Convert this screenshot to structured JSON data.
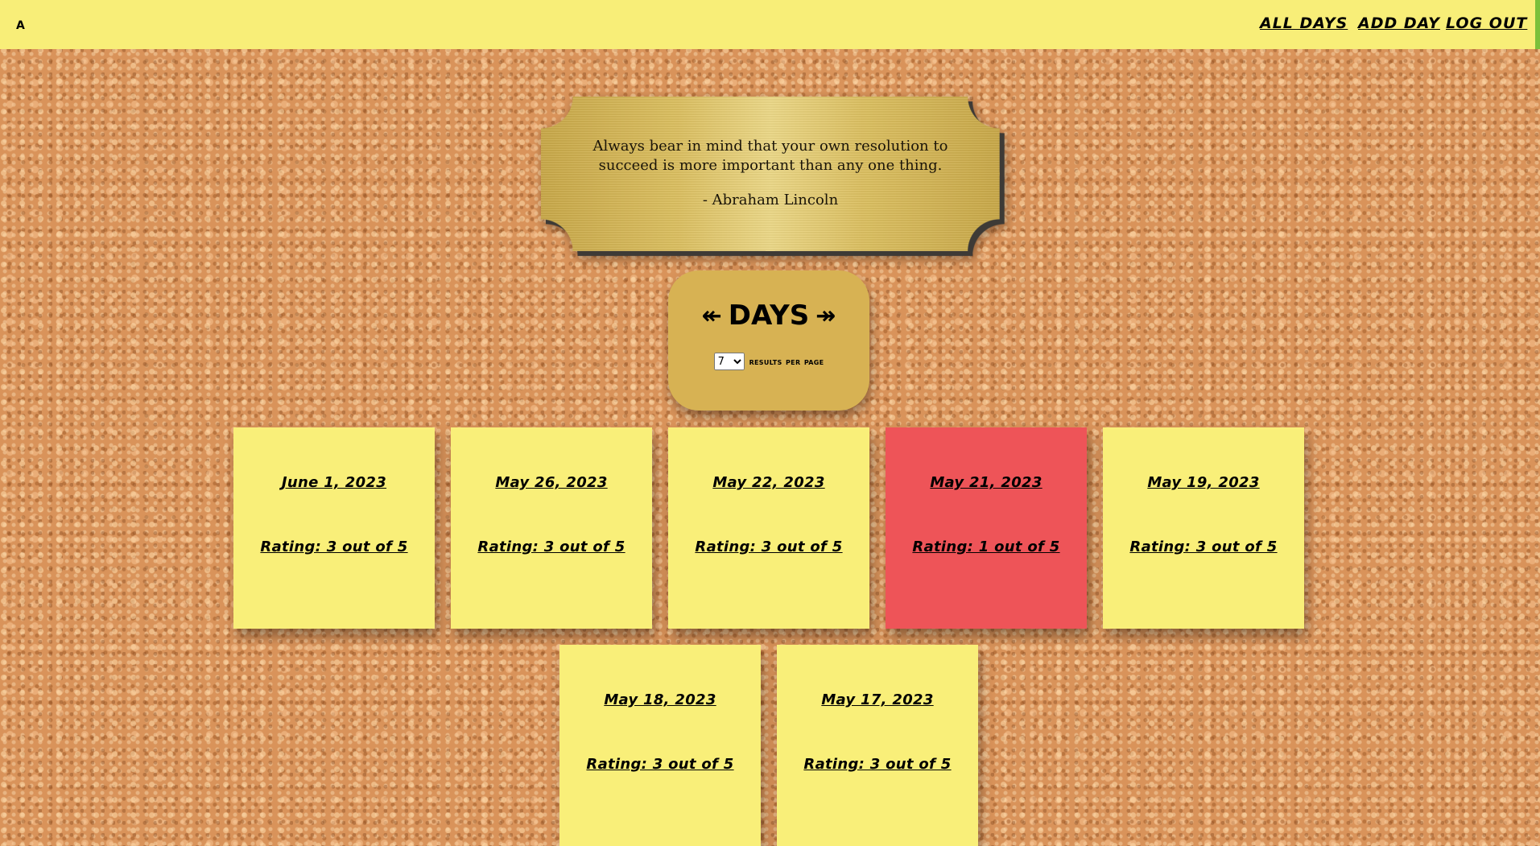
{
  "nav": {
    "brand": "A",
    "links": [
      "All Days",
      "Add Day",
      "Log Out"
    ]
  },
  "quote": {
    "text": "Always bear in mind that your own resolution to succeed is more important than any one thing.",
    "author": "- Abraham Lincoln"
  },
  "days_panel": {
    "prev_arrow": "↞",
    "title": "DAYS",
    "next_arrow": "↠",
    "per_page_value": "7",
    "per_page_options": [
      "7"
    ],
    "per_page_label": "results per page"
  },
  "days": [
    {
      "date": "June 1, 2023",
      "rating": "Rating: 3 out of 5",
      "color": "#f9ef79"
    },
    {
      "date": "May 26, 2023",
      "rating": "Rating: 3 out of 5",
      "color": "#f9ef79"
    },
    {
      "date": "May 22, 2023",
      "rating": "Rating: 3 out of 5",
      "color": "#f9ef79"
    },
    {
      "date": "May 21, 2023",
      "rating": "Rating: 1 out of 5",
      "color": "#ee5458"
    },
    {
      "date": "May 19, 2023",
      "rating": "Rating: 3 out of 5",
      "color": "#f9ef79"
    },
    {
      "date": "May 18, 2023",
      "rating": "Rating: 3 out of 5",
      "color": "#f9ef79"
    },
    {
      "date": "May 17, 2023",
      "rating": "Rating: 3 out of 5",
      "color": "#f9ef79"
    }
  ]
}
